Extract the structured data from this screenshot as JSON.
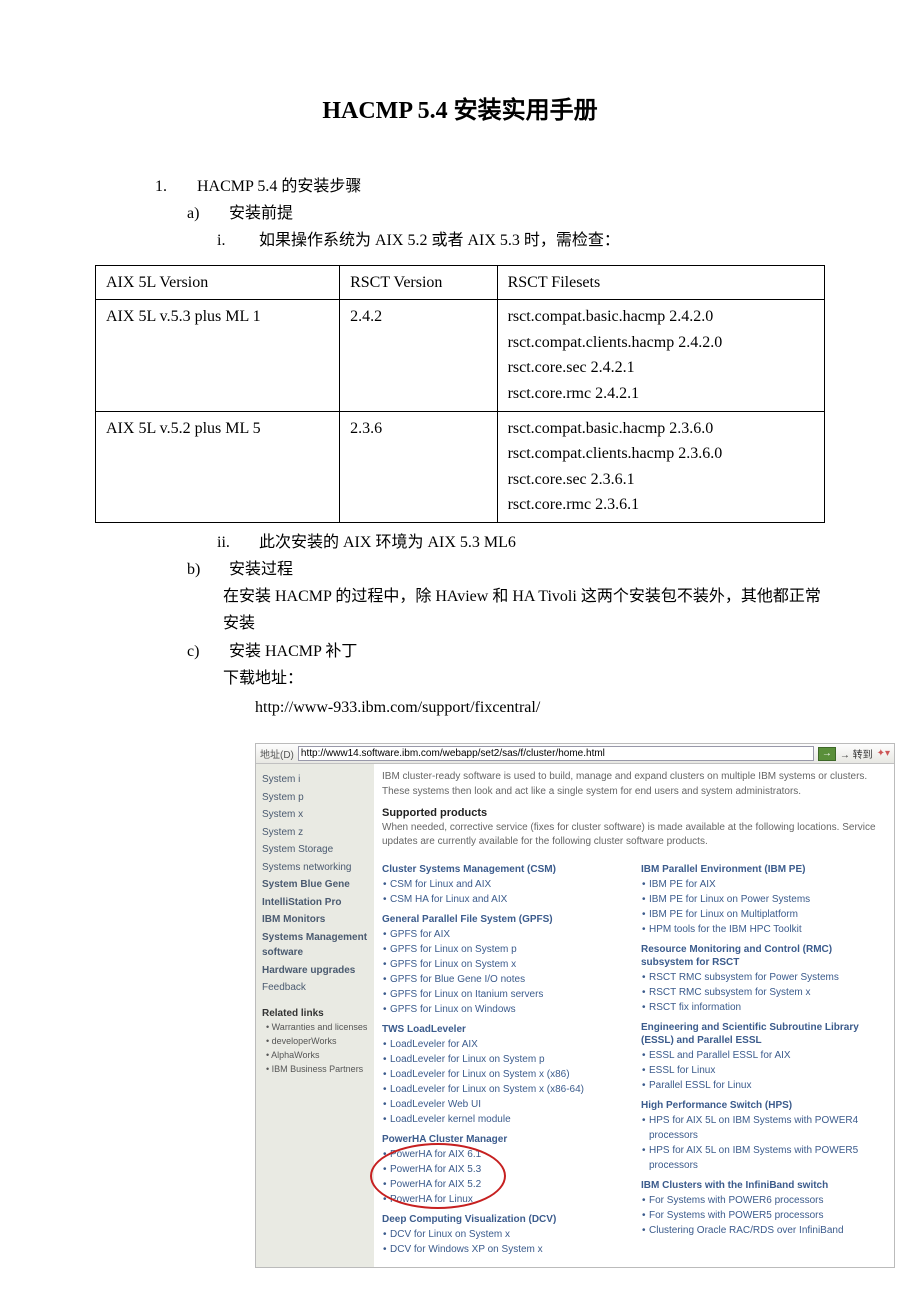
{
  "doc": {
    "title": "HACMP 5.4 安装实用手册",
    "outline": {
      "n1": "1.",
      "t1": "HACMP 5.4 的安装步骤",
      "na": "a)",
      "ta": "安装前提",
      "ni": "i.",
      "ti": "如果操作系统为 AIX 5.2 或者 AIX 5.3 时，需检查：",
      "nii": "ii.",
      "tii": "此次安装的 AIX  环境为 AIX 5.3 ML6",
      "nb": "b)",
      "tb": "安装过程",
      "tb_body": "在安装 HACMP 的过程中，除 HAview 和 HA Tivoli 这两个安装包不装外，其他都正常安装",
      "nc": "c)",
      "tc": "安装 HACMP 补丁",
      "tc_body": "下载地址：",
      "url": "http://www-933.ibm.com/support/fixcentral/"
    },
    "table": {
      "h1": "AIX 5L Version",
      "h2": "RSCT Version",
      "h3": "RSCT Filesets",
      "r1c1": "AIX 5L v.5.3 plus ML 1",
      "r1c2": "2.4.2",
      "r1c3": "rsct.compat.basic.hacmp 2.4.2.0\nrsct.compat.clients.hacmp 2.4.2.0\nrsct.core.sec 2.4.2.1\nrsct.core.rmc 2.4.2.1",
      "r2c1": "AIX 5L v.5.2 plus ML 5",
      "r2c2": "2.3.6",
      "r2c3": "rsct.compat.basic.hacmp 2.3.6.0\nrsct.compat.clients.hacmp 2.3.6.0\nrsct.core.sec 2.3.6.1\nrsct.core.rmc 2.3.6.1"
    }
  },
  "browser": {
    "addr_label": "地址(D)",
    "url": "http://www14.software.ibm.com/webapp/set2/sas/f/cluster/home.html",
    "go": "→",
    "goto": "→ 转到",
    "sidebar": {
      "items": [
        "System i",
        "System p",
        "System x",
        "System z",
        "System Storage",
        "Systems networking",
        "System Blue Gene",
        "IntelliStation Pro",
        "IBM Monitors",
        "Systems Management software",
        "Hardware upgrades",
        "Feedback"
      ],
      "related_title": "Related links",
      "related": [
        "Warranties and licenses",
        "developerWorks",
        "AlphaWorks",
        "IBM Business Partners"
      ]
    },
    "content": {
      "intro": "IBM cluster-ready software is used to build, manage and expand clusters on multiple IBM systems or clusters. These systems then look and act like a single system for end users and system administrators.",
      "sp_title": "Supported products",
      "sp_text": "When needed, corrective service (fixes for cluster software) is made available at the following locations. Service updates are currently available for the following cluster software products.",
      "left_groups": [
        {
          "title": "Cluster Systems Management (CSM)",
          "links": [
            "CSM for Linux and AIX",
            "CSM HA for Linux and AIX"
          ]
        },
        {
          "title": "General Parallel File System (GPFS)",
          "links": [
            "GPFS for AIX",
            "GPFS for Linux on System p",
            "GPFS for Linux on System x",
            "GPFS for Blue Gene I/O notes",
            "GPFS for Linux on Itanium servers",
            "GPFS for Linux on Windows"
          ]
        },
        {
          "title": "TWS LoadLeveler",
          "links": [
            "LoadLeveler for AIX",
            "LoadLeveler for Linux on System p",
            "LoadLeveler for Linux on System x (x86)",
            "LoadLeveler for Linux on System x (x86-64)",
            "LoadLeveler Web UI",
            "LoadLeveler kernel module"
          ]
        },
        {
          "title": "PowerHA Cluster Manager",
          "circle": true,
          "links": [
            "PowerHA for AIX 6.1",
            "PowerHA for AIX 5.3",
            "PowerHA for AIX 5.2",
            "PowerHA for Linux"
          ]
        },
        {
          "title": "Deep Computing Visualization (DCV)",
          "links": [
            "DCV for Linux on System x",
            "DCV for Windows XP on System x"
          ]
        }
      ],
      "right_groups": [
        {
          "title": "IBM Parallel Environment (IBM PE)",
          "links": [
            "IBM PE for AIX",
            "IBM PE for Linux on Power Systems",
            "IBM PE for Linux on Multiplatform",
            "HPM tools for the IBM HPC Toolkit"
          ]
        },
        {
          "title": "Resource Monitoring and Control (RMC) subsystem for RSCT",
          "links": [
            "RSCT RMC subsystem for Power Systems",
            "RSCT RMC subsystem for System x",
            "RSCT fix information"
          ]
        },
        {
          "title": "Engineering and Scientific Subroutine Library (ESSL) and Parallel ESSL",
          "links": [
            "ESSL and Parallel ESSL for AIX",
            "ESSL for Linux",
            "Parallel ESSL for Linux"
          ]
        },
        {
          "title": "High Performance Switch (HPS)",
          "links": [
            "HPS for AIX 5L on IBM Systems with POWER4 processors",
            "HPS for AIX 5L on IBM Systems with POWER5 processors"
          ]
        },
        {
          "title": "IBM Clusters with the InfiniBand switch",
          "links": [
            "For Systems with POWER6 processors",
            "For Systems with POWER5 processors",
            "Clustering Oracle RAC/RDS over InfiniBand"
          ]
        }
      ]
    }
  }
}
